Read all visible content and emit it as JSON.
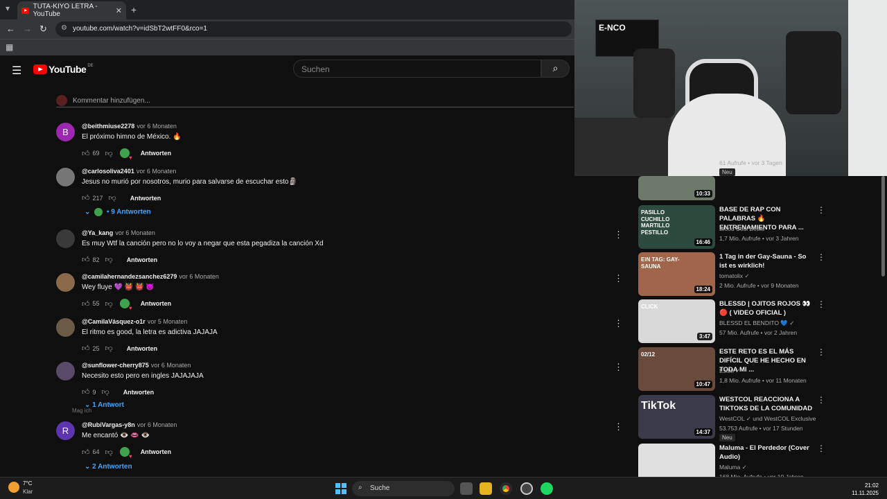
{
  "browser": {
    "tab_title": "TUTA-KIYO LETRA - YouTube",
    "url": "youtube.com/watch?v=idSbT2wtFF0&rco=1"
  },
  "youtube": {
    "logo_text": "YouTube",
    "region": "DE",
    "search_placeholder": "Suchen",
    "add_comment_placeholder": "Kommentar hinzufügen...",
    "reply_label": "Antworten"
  },
  "comments": [
    {
      "user": "@beithmiuse2278",
      "time": "vor 6 Monaten",
      "text": "El próximo himno de México. 🔥",
      "likes": "69",
      "avatar_letter": "B",
      "avatar_color": "#9c27b0",
      "creator_heart": true
    },
    {
      "user": "@carlosoliva2401",
      "time": "vor 6 Monaten",
      "text": "Jesus no murió por nosotros, murio para salvarse de escuchar esto🗿",
      "likes": "217",
      "avatar_letter": "",
      "avatar_color": "#777777",
      "creator_heart": false,
      "replies": "9 Antworten"
    },
    {
      "user": "@Ya_kang",
      "time": "vor 6 Monaten",
      "text": "Es muy Wtf la canción pero no lo voy a negar que esta pegadiza la canción Xd",
      "likes": "82",
      "avatar_letter": "",
      "avatar_color": "#3a3a3a",
      "creator_heart": false
    },
    {
      "user": "@camilahernandezsanchez6279",
      "time": "vor 6 Monaten",
      "text": "Wey fluye 💜 👹 👹 👿",
      "likes": "55",
      "avatar_letter": "",
      "avatar_color": "#8a6a4a",
      "creator_heart": true
    },
    {
      "user": "@CamilaVásquez-o1r",
      "time": "vor 5 Monaten",
      "text": "El ritmo es good, la letra es adictiva JAJAJA",
      "likes": "25",
      "avatar_letter": "",
      "avatar_color": "#6b5a45",
      "creator_heart": false
    },
    {
      "user": "@sunflower-cherry875",
      "time": "vor 6 Monaten",
      "text": "Necesito esto pero en ingles JAJAJAJA",
      "likes": "9",
      "avatar_letter": "",
      "avatar_color": "#5a4a6a",
      "creator_heart": false,
      "replies": "1 Antwort"
    },
    {
      "user": "@RubiVargas-y8n",
      "time": "vor 6 Monaten",
      "text": "Me encantó 👁️ 👄 👁️",
      "likes": "64",
      "avatar_letter": "R",
      "avatar_color": "#5e35b1",
      "creator_heart": true,
      "replies": "2 Antworten"
    }
  ],
  "tooltip": "Mag ich",
  "sidebar": [
    {
      "title": "",
      "channel": "",
      "meta": "61 Aufrufe • vor 3 Tagen",
      "duration": "10:33",
      "badge": "Neu",
      "thumb_color": "#6d7a6a"
    },
    {
      "title": "BASE DE RAP CON PALABRAS 🔥 ENTRENAMIENTO PARA ...",
      "channel": "Blood Soul Beats",
      "meta": "1,7 Mio. Aufrufe • vor 3 Jahren",
      "duration": "16:46",
      "thumb_color": "#2d4a3e",
      "thumb_text": "PASILLO CUCHILLO MARTILLO PESTILLO"
    },
    {
      "title": "1 Tag in der Gay-Sauna - So ist es wirklich!",
      "channel": "tomatolix ✓",
      "meta": "2 Mio. Aufrufe • vor 9 Monaten",
      "duration": "18:24",
      "thumb_color": "#a0654a",
      "thumb_text": "EIN TAG: GAY-SAUNA"
    },
    {
      "title": "BLESSD | OJITOS ROJOS 👀 🔴 ( VIDEO OFICIAL )",
      "channel": "BLESSD EL BENDITO 💙 ✓",
      "meta": "57 Mio. Aufrufe • vor 2 Jahren",
      "duration": "3:47",
      "thumb_color": "#d9d9d9",
      "thumb_text": "CLICK"
    },
    {
      "title": "ESTE RETO ES EL MÁS DIFÍCIL QUE HE HECHO EN TODA MI ...",
      "channel": "Esttik ✓",
      "meta": "1,8 Mio. Aufrufe • vor 11 Monaten",
      "duration": "10:47",
      "thumb_color": "#6a4a3a",
      "thumb_text": "02/12"
    },
    {
      "title": "WESTCOL REACCIONA A TIKTOKS DE LA COMUNIDAD",
      "channel": "WestCOL ✓ und WestCOL Exclusive",
      "meta": "53.753 Aufrufe • vor 17 Stunden",
      "duration": "14:37",
      "badge": "Neu",
      "thumb_color": "#3a3a4a",
      "thumb_text": "TikTok"
    },
    {
      "title": "Maluma - El Perdedor (Cover Audio)",
      "channel": "Maluma ✓",
      "meta": "168 Mio. Aufrufe • vor 10 Jahren",
      "duration": "",
      "thumb_color": "#e0e0e0"
    }
  ],
  "taskbar": {
    "temperature": "7°C",
    "condition": "Klar",
    "search": "Suche",
    "time": "21:02",
    "date": "11.11.2025"
  },
  "webcam": {
    "sign_text": "E-NCO"
  }
}
